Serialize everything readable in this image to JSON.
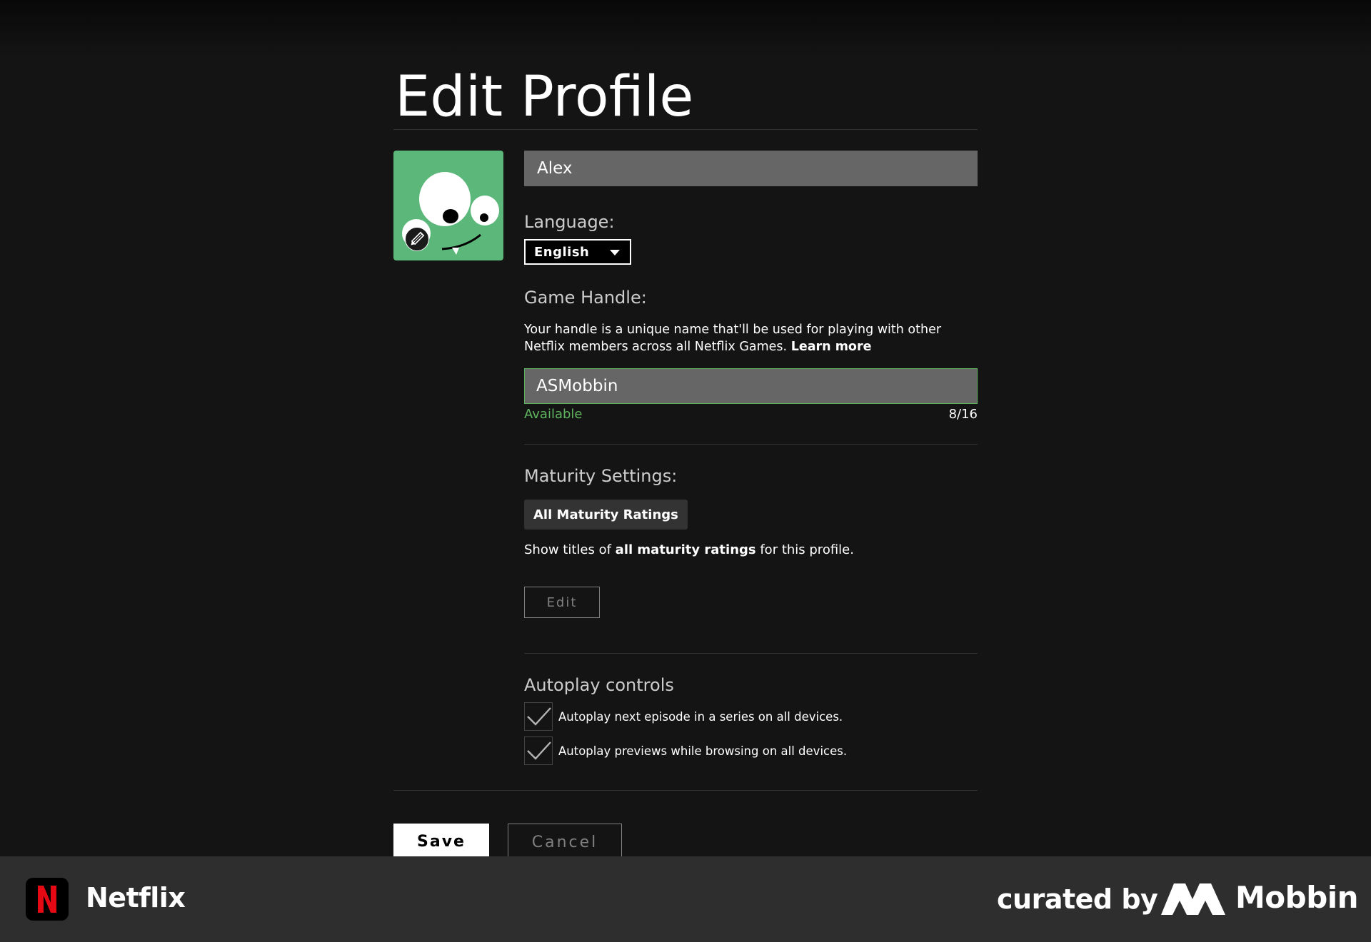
{
  "page": {
    "title": "Edit Profile"
  },
  "profile": {
    "name_value": "Alex",
    "language_label": "Language:",
    "language_selected": "English"
  },
  "game_handle": {
    "label": "Game Handle:",
    "description": "Your handle is a unique name that'll be used for playing with other Netflix members across all Netflix Games.",
    "learn_more": "Learn more",
    "value": "ASMobbin",
    "status": "Available",
    "count": "8/16"
  },
  "maturity": {
    "label": "Maturity Settings:",
    "badge": "All Maturity Ratings",
    "desc_prefix": "Show titles of",
    "desc_bold": "all maturity ratings",
    "desc_suffix": "for this profile.",
    "edit_label": "Edit"
  },
  "autoplay": {
    "label": "Autoplay controls",
    "options": [
      {
        "label": "Autoplay next episode in a series on all devices.",
        "checked": true
      },
      {
        "label": "Autoplay previews while browsing on all devices.",
        "checked": true
      }
    ]
  },
  "actions": {
    "save_label": "Save",
    "cancel_label": "Cancel"
  },
  "footer": {
    "app_name": "Netflix",
    "curated_by": "curated by",
    "brand": "Mobbin"
  },
  "colors": {
    "background": "#141414",
    "input_bg": "#666666",
    "available_green": "#5fb55f",
    "avatar_green": "#5cb87a",
    "netflix_red": "#e50914",
    "footer_bg": "#2e2e2e"
  },
  "icons": {
    "avatar_edit": "pencil-icon",
    "dropdown": "caret-down-icon",
    "check": "checkmark-icon",
    "app": "netflix-n-icon",
    "brand": "mobbin-logo-icon"
  }
}
